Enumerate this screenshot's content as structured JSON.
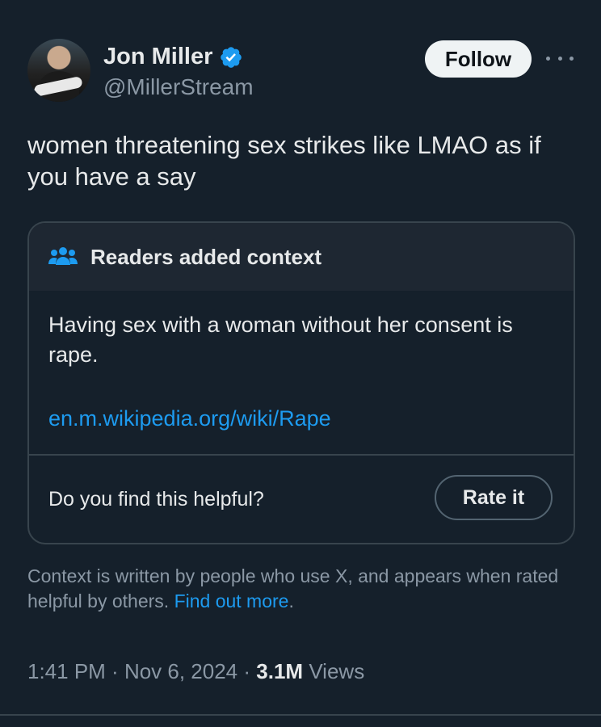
{
  "author": {
    "name": "Jon Miller",
    "handle": "@MillerStream",
    "verified": true,
    "avatar_icon": "profile-photo"
  },
  "actions": {
    "follow_label": "Follow",
    "more_icon": "ellipsis-icon"
  },
  "tweet": {
    "text": "women threatening sex strikes like LMAO as if you have a say"
  },
  "community_note": {
    "header_icon": "people-icon",
    "title": "Readers added context",
    "body": "Having sex with a woman without her consent is rape.",
    "link": "en.m.wikipedia.org/wiki/Rape",
    "helpful_question": "Do you find this helpful?",
    "rate_label": "Rate it"
  },
  "context_info": {
    "text": "Context is written by people who use X, and appears when rated helpful by others.",
    "link_label": "Find out more",
    "trailing": "."
  },
  "meta": {
    "time": "1:41 PM",
    "date": "Nov 6, 2024",
    "separator": " · ",
    "views_count": "3.1M",
    "views_label": "Views"
  },
  "colors": {
    "background": "#15202b",
    "accent": "#1d9bf0",
    "muted": "#8b98a5",
    "border": "#38444d"
  }
}
